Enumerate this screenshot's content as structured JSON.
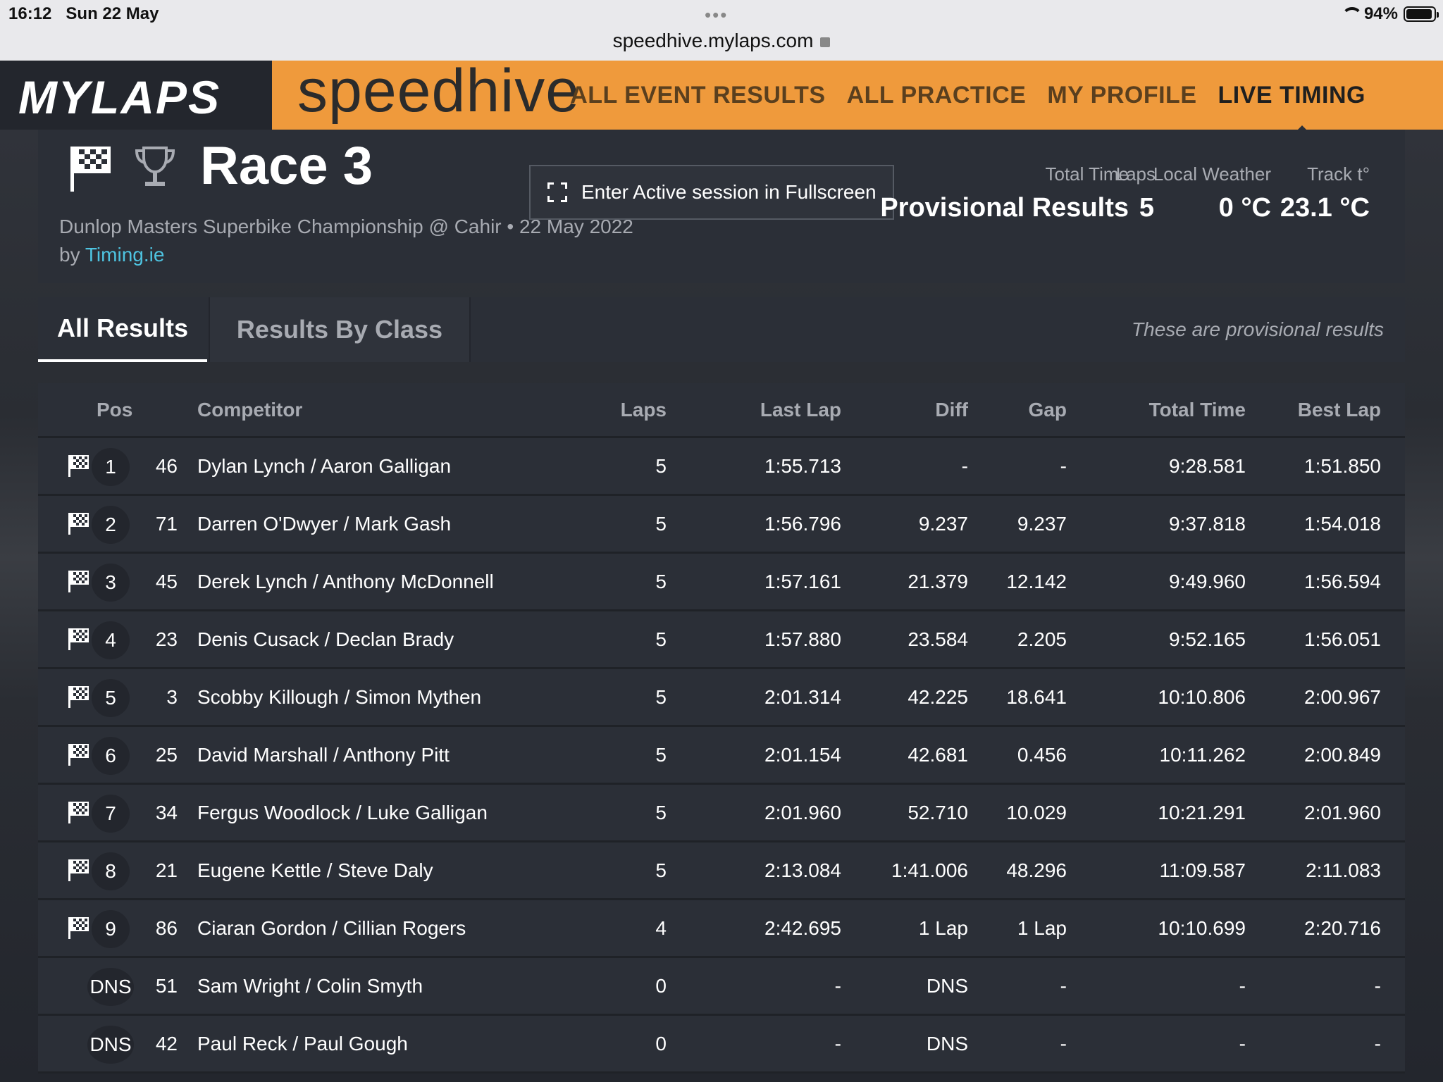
{
  "status_bar": {
    "time": "16:12",
    "date": "Sun 22 May",
    "url": "speedhive.mylaps.com",
    "battery": "94%",
    "battery_level": 0.94
  },
  "header": {
    "logo": "MYLAPS",
    "brand": "speedhive",
    "nav": [
      "ALL EVENT RESULTS",
      "ALL PRACTICE",
      "MY PROFILE",
      "LIVE TIMING"
    ],
    "active_nav": "LIVE TIMING",
    "orange": "#ef9a3c"
  },
  "session": {
    "title": "Race 3",
    "subtitle": "Dunlop Masters Superbike Championship @ Cahir • 22 May 2022 by ",
    "organizer": "Timing.ie",
    "fullscreen_label": "Enter Active session in Fullscreen",
    "total_time_label": "Total Time",
    "total_time_value": "Provisional Results",
    "laps_label": "Laps",
    "laps_value": "5",
    "weather_label": "Local Weather",
    "weather_value": "0 °C",
    "track_label": "Track t°",
    "track_value": "23.1 °C"
  },
  "tabs": {
    "all": "All Results",
    "by_class": "Results By Class",
    "note": "These are provisional results"
  },
  "table": {
    "headers": {
      "pos": "Pos",
      "competitor": "Competitor",
      "laps": "Laps",
      "last_lap": "Last Lap",
      "diff": "Diff",
      "gap": "Gap",
      "total_time": "Total Time",
      "best_lap": "Best Lap"
    },
    "rows": [
      {
        "pos": "1",
        "num": "46",
        "name": "Dylan Lynch / Aaron Galligan",
        "laps": "5",
        "last": "1:55.713",
        "diff": "-",
        "gap": "-",
        "total": "9:28.581",
        "best": "1:51.850",
        "flag": true
      },
      {
        "pos": "2",
        "num": "71",
        "name": "Darren O'Dwyer / Mark Gash",
        "laps": "5",
        "last": "1:56.796",
        "diff": "9.237",
        "gap": "9.237",
        "total": "9:37.818",
        "best": "1:54.018",
        "flag": true
      },
      {
        "pos": "3",
        "num": "45",
        "name": "Derek Lynch / Anthony McDonnell",
        "laps": "5",
        "last": "1:57.161",
        "diff": "21.379",
        "gap": "12.142",
        "total": "9:49.960",
        "best": "1:56.594",
        "flag": true
      },
      {
        "pos": "4",
        "num": "23",
        "name": "Denis Cusack / Declan Brady",
        "laps": "5",
        "last": "1:57.880",
        "diff": "23.584",
        "gap": "2.205",
        "total": "9:52.165",
        "best": "1:56.051",
        "flag": true
      },
      {
        "pos": "5",
        "num": "3",
        "name": "Scobby Killough / Simon Mythen",
        "laps": "5",
        "last": "2:01.314",
        "diff": "42.225",
        "gap": "18.641",
        "total": "10:10.806",
        "best": "2:00.967",
        "flag": true
      },
      {
        "pos": "6",
        "num": "25",
        "name": "David Marshall / Anthony Pitt",
        "laps": "5",
        "last": "2:01.154",
        "diff": "42.681",
        "gap": "0.456",
        "total": "10:11.262",
        "best": "2:00.849",
        "flag": true
      },
      {
        "pos": "7",
        "num": "34",
        "name": "Fergus Woodlock / Luke Galligan",
        "laps": "5",
        "last": "2:01.960",
        "diff": "52.710",
        "gap": "10.029",
        "total": "10:21.291",
        "best": "2:01.960",
        "flag": true
      },
      {
        "pos": "8",
        "num": "21",
        "name": "Eugene Kettle / Steve Daly",
        "laps": "5",
        "last": "2:13.084",
        "diff": "1:41.006",
        "gap": "48.296",
        "total": "11:09.587",
        "best": "2:11.083",
        "flag": true
      },
      {
        "pos": "9",
        "num": "86",
        "name": "Ciaran Gordon / Cillian Rogers",
        "laps": "4",
        "last": "2:42.695",
        "diff": "1 Lap",
        "gap": "1 Lap",
        "total": "10:10.699",
        "best": "2:20.716",
        "flag": true
      },
      {
        "pos": "DNS",
        "num": "51",
        "name": "Sam Wright / Colin Smyth",
        "laps": "0",
        "last": "-",
        "diff": "DNS",
        "gap": "-",
        "total": "-",
        "best": "-",
        "flag": false
      },
      {
        "pos": "DNS",
        "num": "42",
        "name": "Paul Reck / Paul Gough",
        "laps": "0",
        "last": "-",
        "diff": "DNS",
        "gap": "-",
        "total": "-",
        "best": "-",
        "flag": false
      }
    ]
  }
}
